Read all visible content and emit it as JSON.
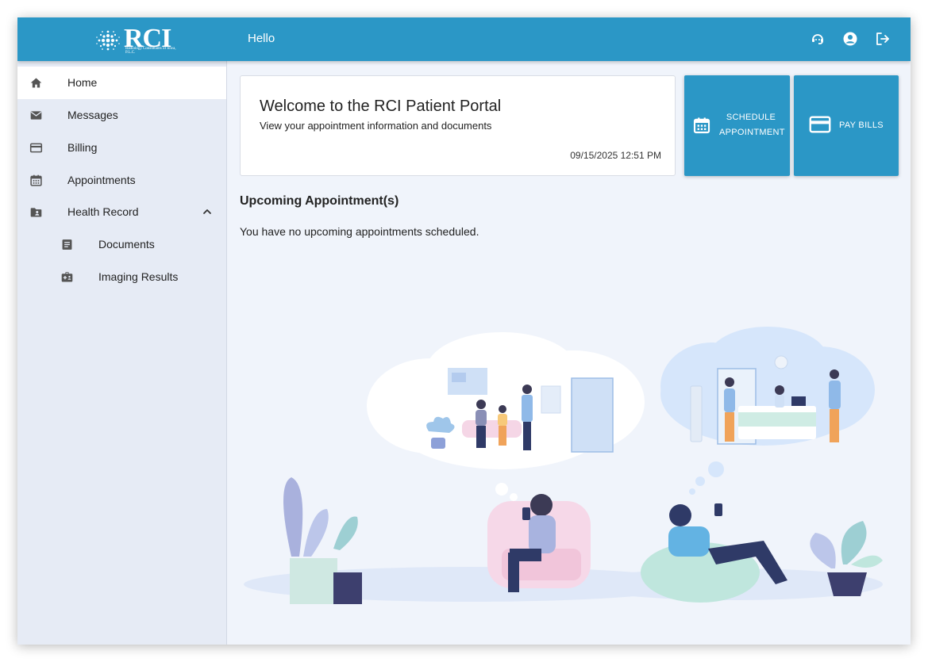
{
  "header": {
    "logo_text": "RCI",
    "logo_subtitle": "Radiology Consultants of Iowa, P.L.C.",
    "greeting": "Hello",
    "icons": [
      "support-agent-icon",
      "account-icon",
      "logout-icon"
    ]
  },
  "sidebar": {
    "items": [
      {
        "label": "Home",
        "icon": "home-icon",
        "active": true
      },
      {
        "label": "Messages",
        "icon": "mail-icon"
      },
      {
        "label": "Billing",
        "icon": "credit-card-icon"
      },
      {
        "label": "Appointments",
        "icon": "calendar-icon"
      },
      {
        "label": "Health Record",
        "icon": "folder-user-icon",
        "expanded": true
      },
      {
        "label": "Documents",
        "icon": "document-icon"
      },
      {
        "label": "Imaging Results",
        "icon": "medical-id-icon"
      }
    ]
  },
  "welcome": {
    "title": "Welcome to the RCI Patient Portal",
    "subtitle": "View your appointment information and documents",
    "timestamp": "09/15/2025 12:51 PM"
  },
  "actions": {
    "schedule_line1": "SCHEDULE",
    "schedule_line2": "APPOINTMENT",
    "pay_label": "PAY BILLS"
  },
  "appointments": {
    "heading": "Upcoming Appointment(s)",
    "empty_message": "You have no upcoming appointments scheduled."
  },
  "colors": {
    "primary": "#2b97c6",
    "sidebar_bg": "#e6ebf5",
    "content_bg": "#f0f4fb"
  }
}
